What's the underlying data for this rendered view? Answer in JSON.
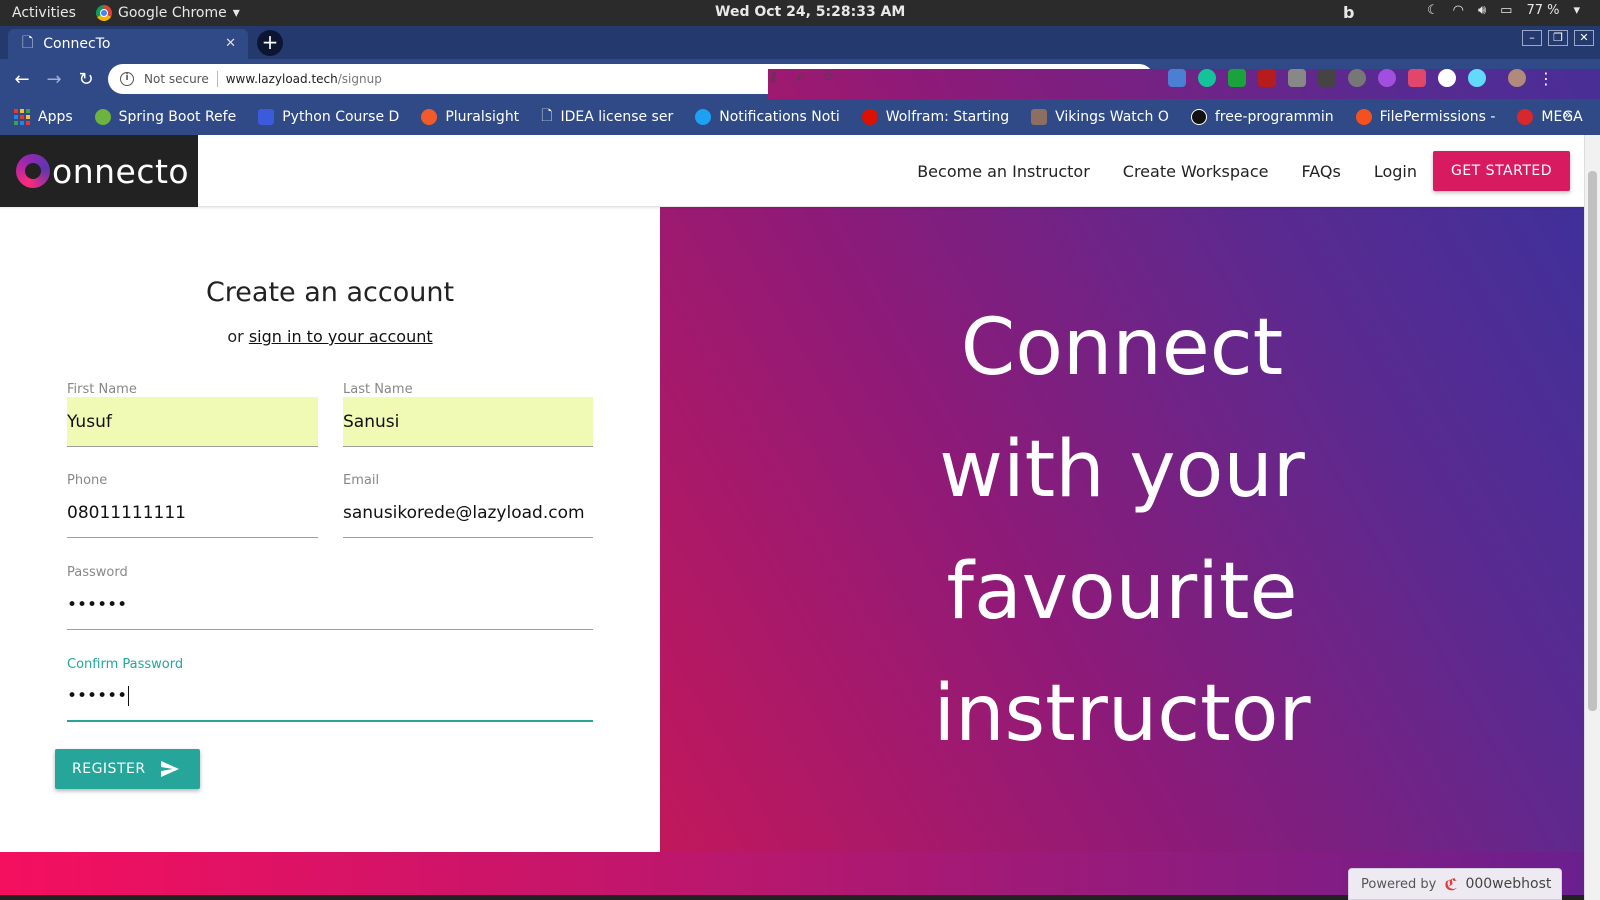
{
  "system": {
    "activities": "Activities",
    "app_name": "Google Chrome",
    "clock": "Wed Oct 24,  5:28:33 AM",
    "battery": "77 %"
  },
  "browser": {
    "tab_title": "ConnecTo",
    "url_security": "Not secure",
    "url_host": "www.lazyload.tech",
    "url_path": "/signup",
    "bookmarks": [
      {
        "label": "Apps",
        "color": "#e53935"
      },
      {
        "label": "Spring Boot Refe",
        "color": "#6db33f"
      },
      {
        "label": "Python Course D",
        "color": "#3b5bdb"
      },
      {
        "label": "Pluralsight",
        "color": "#f15b2a"
      },
      {
        "label": "IDEA license ser",
        "color": "#ffffff"
      },
      {
        "label": "Notifications Noti",
        "color": "#1da1f2"
      },
      {
        "label": "Wolfram: Starting",
        "color": "#dd1100"
      },
      {
        "label": "Vikings Watch O",
        "color": "#8d6e63"
      },
      {
        "label": "free-programmin",
        "color": "#ffffff"
      },
      {
        "label": "FilePermissions -",
        "color": "#f4511e"
      },
      {
        "label": "MEGA",
        "color": "#d9272e"
      }
    ],
    "bookmarks_more": "»"
  },
  "site": {
    "brand": "onnecto",
    "nav": [
      "Become an Instructor",
      "Create Workspace",
      "FAQs",
      "Login"
    ],
    "cta": "GET STARTED"
  },
  "form": {
    "title": "Create an account",
    "or_text": "or ",
    "signin_link": "sign in to your account",
    "first_name": {
      "label": "First Name",
      "value": "Yusuf"
    },
    "last_name": {
      "label": "Last Name",
      "value": "Sanusi"
    },
    "phone": {
      "label": "Phone",
      "value": "08011111111"
    },
    "email": {
      "label": "Email",
      "value": "sanusikorede@lazyload.com"
    },
    "password": {
      "label": "Password",
      "value": "••••••"
    },
    "confirm_password": {
      "label": "Confirm Password",
      "value": "••••••"
    },
    "register": "REGISTER"
  },
  "hero": {
    "line1": "Connect",
    "line2": "with your",
    "line3": "favourite",
    "line4": "instructor"
  },
  "footer": {
    "powered_by": "Powered by",
    "host": "000webhost"
  },
  "colors": {
    "accent_teal": "#26a69a",
    "cta_pink": "#d81b60",
    "autofill": "#f0fab4"
  }
}
